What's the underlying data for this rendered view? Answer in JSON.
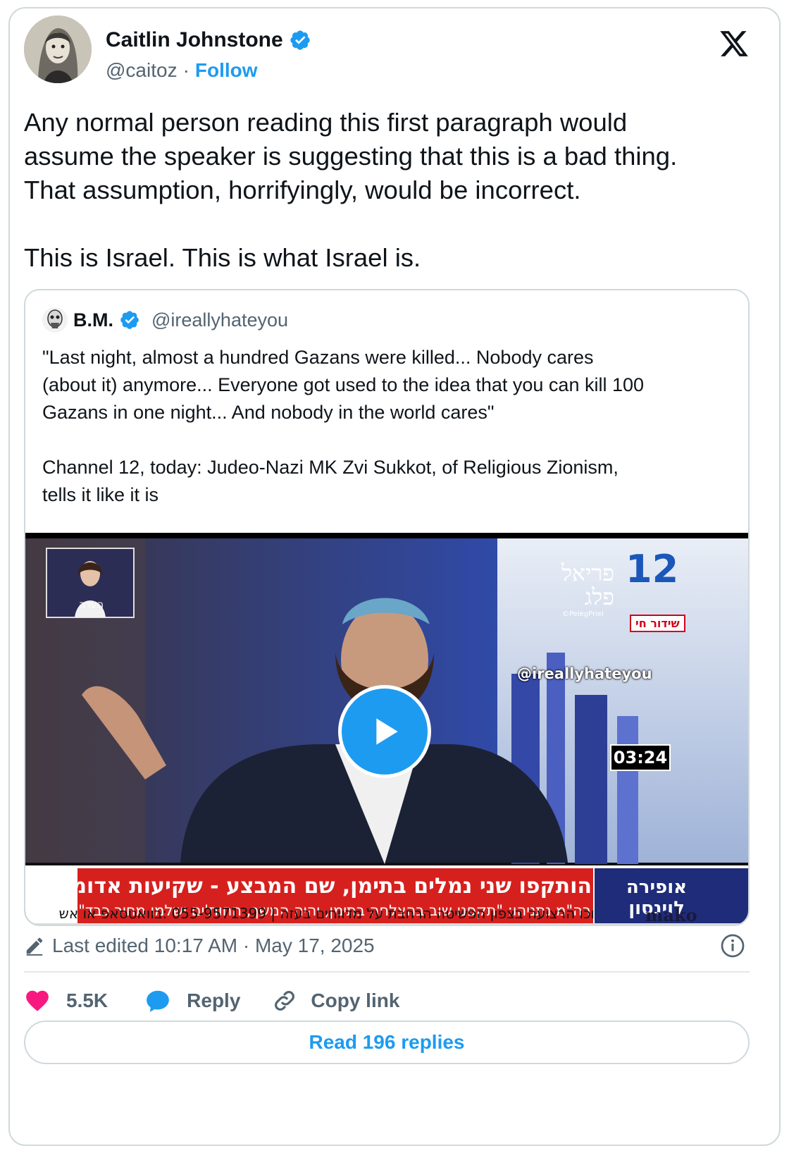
{
  "author": {
    "name": "Caitlin Johnstone",
    "handle": "@caitoz",
    "separator": "·",
    "follow_label": "Follow"
  },
  "tweet": {
    "text": "Any normal person reading this first paragraph would\nassume the speaker is suggesting that this is a bad thing.\nThat assumption, horrifyingly, would be incorrect.\n\nThis is Israel. This is what Israel is."
  },
  "quote": {
    "name": "B.M.",
    "handle": "@ireallyhateyou",
    "text": "\"Last night, almost a hundred Gazans were killed... Nobody cares\n(about it) anymore... Everyone got used to the idea that you can kill 100\nGazans in one night... And nobody in the world cares\"\n\nChannel 12, today: Judeo-Nazi MK Zvi Sukkot, of Religious Zionism,\ntells it like it is",
    "video": {
      "duration": "03:24",
      "overlay_handle": "@ireallyhateyou",
      "ticker_headline": "הותקפו שני נמלים בתימן, שם המבצע - שקיעות אדומות",
      "ticker_sub": "רה\"מ נתניהו: \"תקפנו שוב בהצלחה בתימן, יהיה המשך, החות'ים ישלמו מחיר כבד\"",
      "ticker_bottom": "וכו הרצועה בצפון הפשיטה הרחבת על מדווחים בעזה | 055-9571399 :בוואטסאפ או אש",
      "channel_badge": "אופירה לוינסון",
      "channel_number": "12",
      "live_label": "שידור חי",
      "mako_logo": "mako",
      "pip_label": "הערה",
      "presenter_name": "פריאל פלג",
      "presenter_small": "©PelegPriel"
    }
  },
  "meta": {
    "edited": "Last edited 10:17 AM · May 17, 2025"
  },
  "actions": {
    "likes": "5.5K",
    "reply": "Reply",
    "copy_link": "Copy link"
  },
  "read_replies": "Read 196 replies",
  "colors": {
    "accent": "#1d9bf0",
    "like": "#f91880",
    "text": "#0f1419",
    "secondary": "#536471",
    "border": "#cfd9de"
  }
}
